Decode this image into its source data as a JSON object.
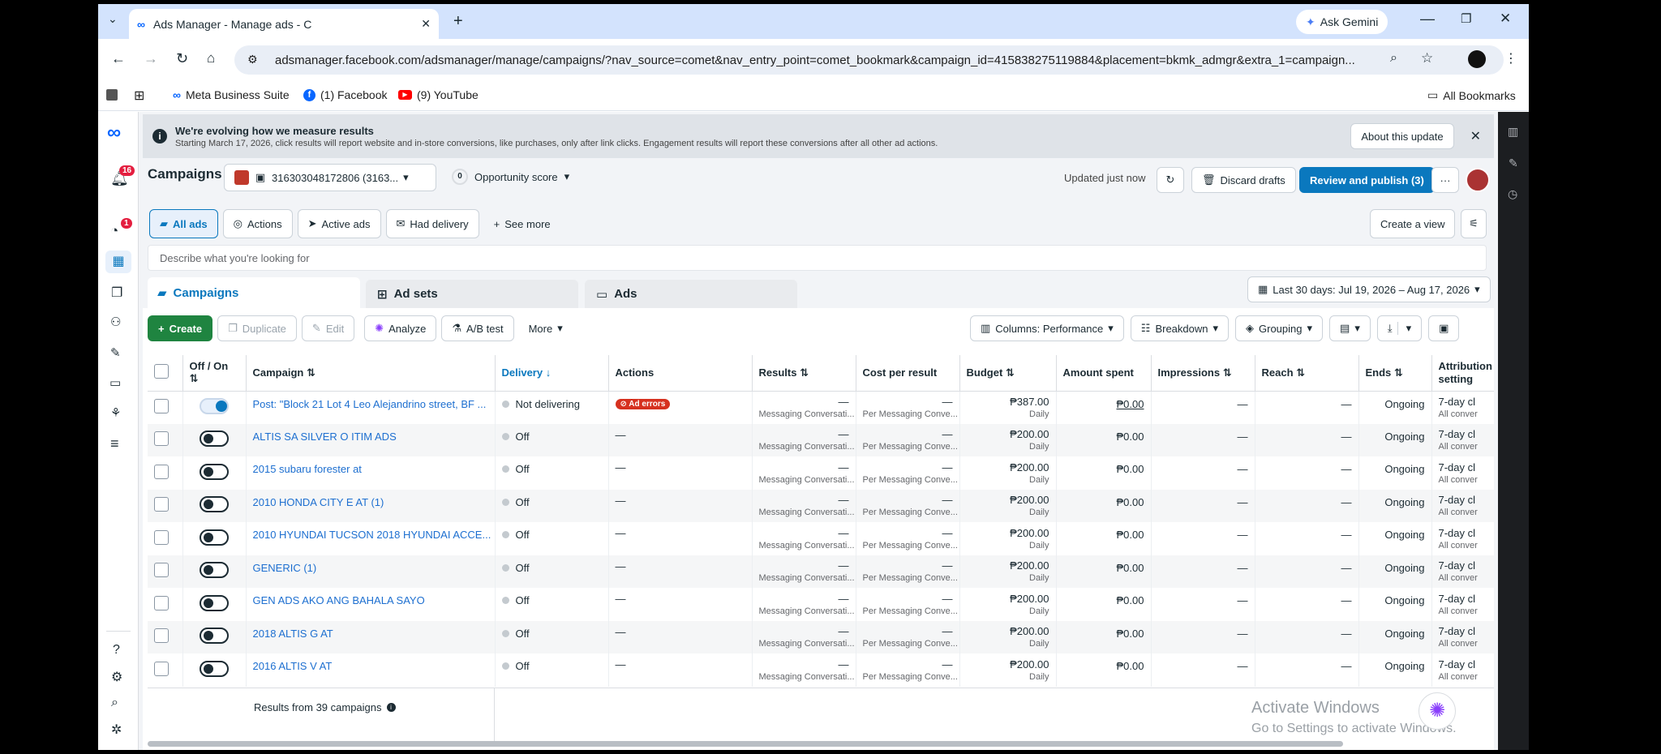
{
  "browser": {
    "tab_title": "Ads Manager - Manage ads - C",
    "url": "adsmanager.facebook.com/adsmanager/manage/campaigns/?nav_source=comet&nav_entry_point=comet_bookmark&campaign_id=415838275119884&placement=bkmk_admgr&extra_1=campaign...",
    "ask_gemini": "Ask Gemini",
    "bookmarks": [
      "Meta Business Suite",
      "(1) Facebook",
      "(9) YouTube"
    ],
    "all_bookmarks": "All Bookmarks"
  },
  "rail": {
    "notif_count": "16",
    "alerts_count": "1"
  },
  "banner": {
    "title": "We're evolving how we measure results",
    "text": "Starting March 17, 2026, click results will report website and in-store conversions, like purchases, only after link clicks. Engagement results will report these conversions after all other ad actions.",
    "about": "About this update"
  },
  "header": {
    "title": "Campaigns",
    "account": "316303048172806 (3163...",
    "opp_count": "0",
    "opportunity": "Opportunity score",
    "updated": "Updated just now",
    "discard": "Discard drafts",
    "review": "Review and publish (3)"
  },
  "filters": {
    "items": [
      "All ads",
      "Actions",
      "Active ads",
      "Had delivery"
    ],
    "see_more": "See more",
    "create_view": "Create a view"
  },
  "search": {
    "placeholder": "Describe what you're looking for"
  },
  "levels": {
    "tabs": [
      "Campaigns",
      "Ad sets",
      "Ads"
    ],
    "date_range": "Last 30 days: Jul 19, 2026 – Aug 17, 2026"
  },
  "toolbar": {
    "create": "Create",
    "duplicate": "Duplicate",
    "edit": "Edit",
    "analyze": "Analyze",
    "abtest": "A/B test",
    "more": "More",
    "columns": "Columns: Performance",
    "breakdown": "Breakdown",
    "grouping": "Grouping"
  },
  "table": {
    "headers": [
      "Off / On",
      "Campaign",
      "Delivery",
      "Actions",
      "Results",
      "Cost per result",
      "Budget",
      "Amount spent",
      "Impressions",
      "Reach",
      "Ends",
      "Attribution setting"
    ],
    "rows": [
      {
        "on": true,
        "name": "Post: \"Block 21 Lot 4 Leo Alejandrino street, BF ...",
        "delivery": "Not delivering",
        "actions": "Ad errors",
        "results": "—",
        "results_sub": "Messaging Conversati...",
        "cpr": "—",
        "cpr_sub": "Per Messaging Conve...",
        "budget": "₱387.00",
        "budget_sub": "Daily",
        "spent": "₱0.00",
        "impr": "—",
        "reach": "—",
        "ends": "Ongoing",
        "attr": "7-day cl",
        "attr_sub": "All conver"
      },
      {
        "on": false,
        "name": "ALTIS SA SILVER O ITIM ADS",
        "delivery": "Off",
        "actions": "—",
        "results": "—",
        "results_sub": "Messaging Conversati...",
        "cpr": "—",
        "cpr_sub": "Per Messaging Conve...",
        "budget": "₱200.00",
        "budget_sub": "Daily",
        "spent": "₱0.00",
        "impr": "—",
        "reach": "—",
        "ends": "Ongoing",
        "attr": "7-day cl",
        "attr_sub": "All conver"
      },
      {
        "on": false,
        "name": "2015 subaru forester at",
        "delivery": "Off",
        "actions": "—",
        "results": "—",
        "results_sub": "Messaging Conversati...",
        "cpr": "—",
        "cpr_sub": "Per Messaging Conve...",
        "budget": "₱200.00",
        "budget_sub": "Daily",
        "spent": "₱0.00",
        "impr": "—",
        "reach": "—",
        "ends": "Ongoing",
        "attr": "7-day cl",
        "attr_sub": "All conver"
      },
      {
        "on": false,
        "name": "2010 HONDA CITY E AT (1)",
        "delivery": "Off",
        "actions": "—",
        "results": "—",
        "results_sub": "Messaging Conversati...",
        "cpr": "—",
        "cpr_sub": "Per Messaging Conve...",
        "budget": "₱200.00",
        "budget_sub": "Daily",
        "spent": "₱0.00",
        "impr": "—",
        "reach": "—",
        "ends": "Ongoing",
        "attr": "7-day cl",
        "attr_sub": "All conver"
      },
      {
        "on": false,
        "name": "2010 HYUNDAI TUCSON 2018 HYUNDAI ACCE...",
        "delivery": "Off",
        "actions": "—",
        "results": "—",
        "results_sub": "Messaging Conversati...",
        "cpr": "—",
        "cpr_sub": "Per Messaging Conve...",
        "budget": "₱200.00",
        "budget_sub": "Daily",
        "spent": "₱0.00",
        "impr": "—",
        "reach": "—",
        "ends": "Ongoing",
        "attr": "7-day cl",
        "attr_sub": "All conver"
      },
      {
        "on": false,
        "name": "GENERIC (1)",
        "delivery": "Off",
        "actions": "—",
        "results": "—",
        "results_sub": "Messaging Conversati...",
        "cpr": "—",
        "cpr_sub": "Per Messaging Conve...",
        "budget": "₱200.00",
        "budget_sub": "Daily",
        "spent": "₱0.00",
        "impr": "—",
        "reach": "—",
        "ends": "Ongoing",
        "attr": "7-day cl",
        "attr_sub": "All conver"
      },
      {
        "on": false,
        "name": "GEN ADS AKO ANG BAHALA SAYO",
        "delivery": "Off",
        "actions": "—",
        "results": "—",
        "results_sub": "Messaging Conversati...",
        "cpr": "—",
        "cpr_sub": "Per Messaging Conve...",
        "budget": "₱200.00",
        "budget_sub": "Daily",
        "spent": "₱0.00",
        "impr": "—",
        "reach": "—",
        "ends": "Ongoing",
        "attr": "7-day cl",
        "attr_sub": "All conver"
      },
      {
        "on": false,
        "name": "2018 ALTIS G AT",
        "delivery": "Off",
        "actions": "—",
        "results": "—",
        "results_sub": "Messaging Conversati...",
        "cpr": "—",
        "cpr_sub": "Per Messaging Conve...",
        "budget": "₱200.00",
        "budget_sub": "Daily",
        "spent": "₱0.00",
        "impr": "—",
        "reach": "—",
        "ends": "Ongoing",
        "attr": "7-day cl",
        "attr_sub": "All conver"
      },
      {
        "on": false,
        "name": "2016 ALTIS V AT",
        "delivery": "Off",
        "actions": "—",
        "results": "—",
        "results_sub": "Messaging Conversati...",
        "cpr": "—",
        "cpr_sub": "Per Messaging Conve...",
        "budget": "₱200.00",
        "budget_sub": "Daily",
        "spent": "₱0.00",
        "impr": "—",
        "reach": "—",
        "ends": "Ongoing",
        "attr": "7-day cl",
        "attr_sub": "All conver"
      }
    ],
    "footer": "Results from 39 campaigns"
  },
  "watermark": {
    "line1": "Activate Windows",
    "line2": "Go to Settings to activate Windows."
  }
}
